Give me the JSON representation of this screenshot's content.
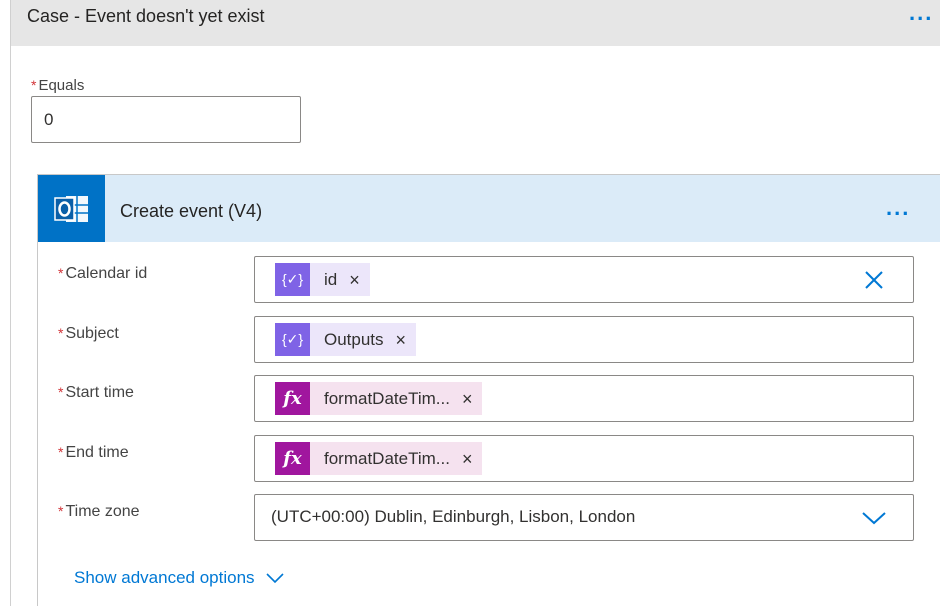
{
  "case": {
    "title": "Case - Event doesn't yet exist",
    "equals_label": "Equals",
    "equals_value": "0",
    "more_menu": "..."
  },
  "action": {
    "title": "Create event (V4)",
    "icon": "outlook-calendar-icon",
    "more_menu": "..."
  },
  "fields": {
    "calendar_id": {
      "label": "Calendar id",
      "token": "id",
      "token_type": "variable-token-icon"
    },
    "subject": {
      "label": "Subject",
      "token": "Outputs",
      "token_type": "variable-token-icon"
    },
    "start_time": {
      "label": "Start time",
      "token": "formatDateTim...",
      "token_type": "expression-fx-icon"
    },
    "end_time": {
      "label": "End time",
      "token": "formatDateTim...",
      "token_type": "expression-fx-icon"
    },
    "time_zone": {
      "label": "Time zone",
      "value": "(UTC+00:00) Dublin, Edinburgh, Lisbon, London"
    }
  },
  "required_mark": "*",
  "remove_mark": "×",
  "show_advanced": "Show advanced options",
  "colors": {
    "accent": "#0078d4",
    "action_header_bg": "#dbebf8",
    "outlook_blue": "#0072c6",
    "variable_token": "#7f63e6",
    "expression_token": "#a0169e",
    "required": "#d13438"
  }
}
